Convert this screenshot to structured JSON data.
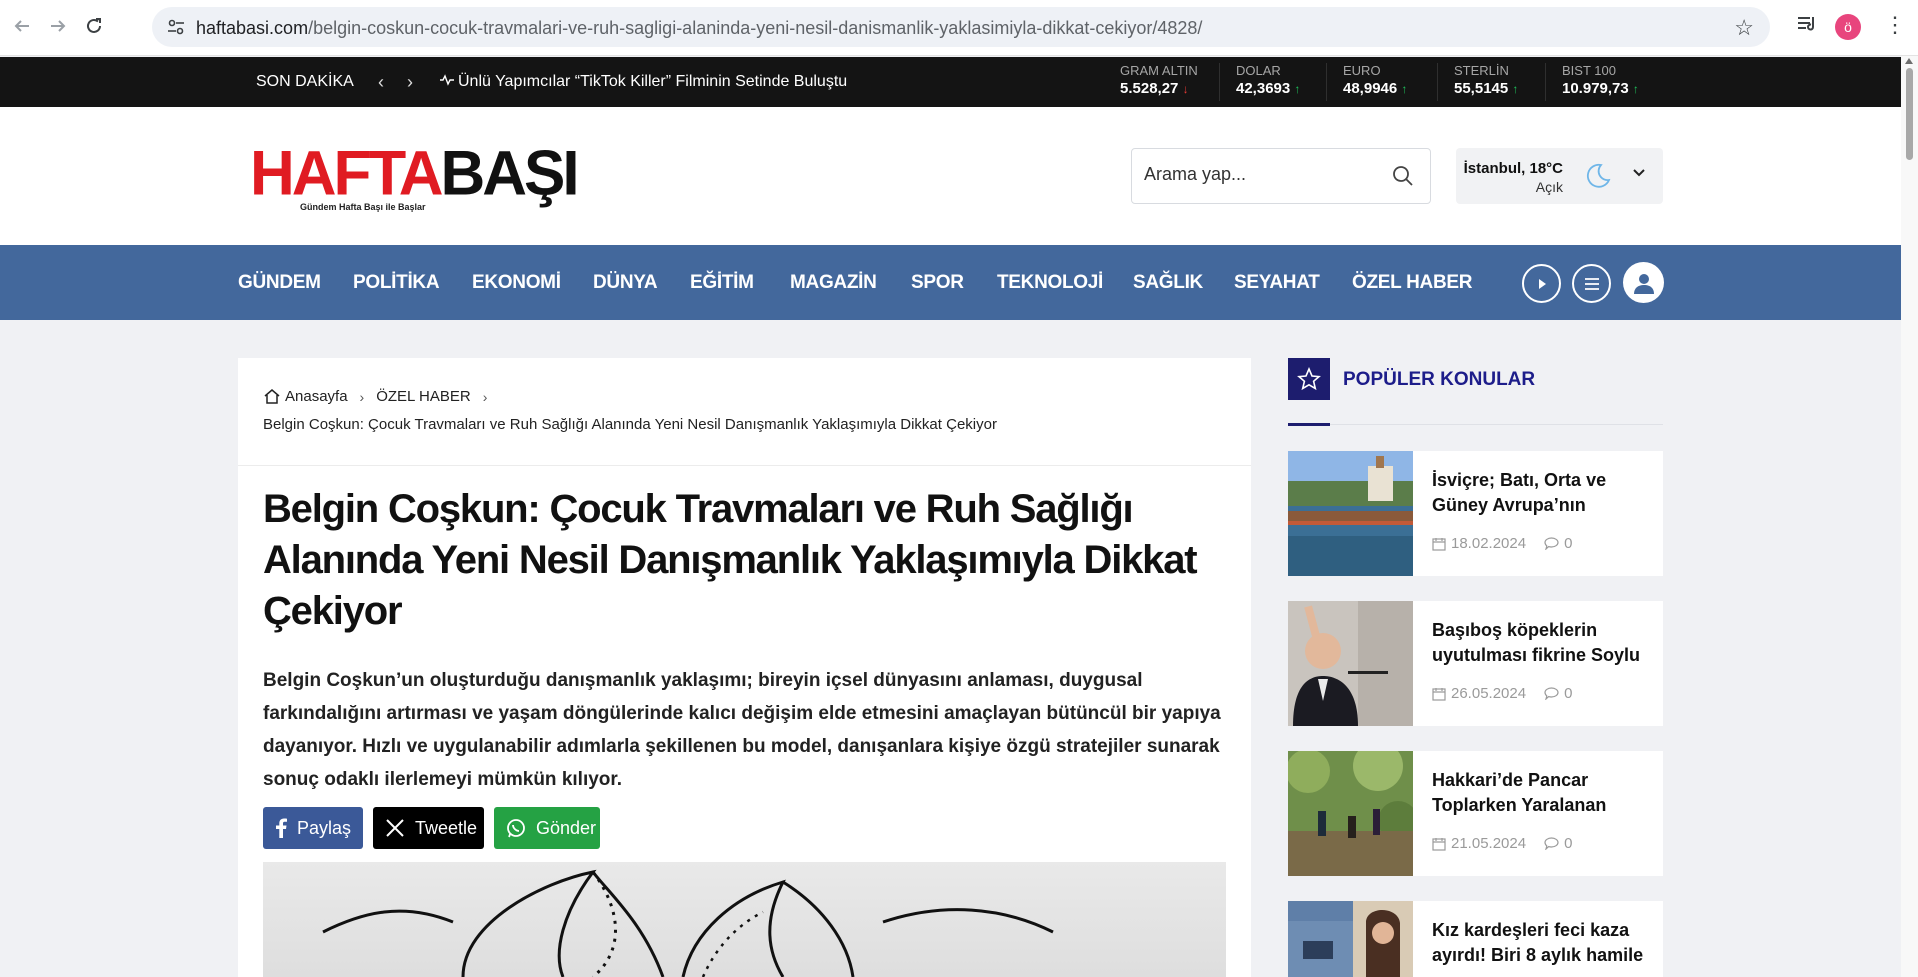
{
  "browser": {
    "url_host": "haftabasi.com",
    "url_path": "/belgin-coskun-cocuk-travmalari-ve-ruh-sagligi-alaninda-yeni-nesil-danismanlik-yaklasimiyla-dikkat-cekiyor/4828/",
    "profile_initial": "ö"
  },
  "ticker": {
    "label": "SON DAKİKA",
    "news": "Ünlü Yapımcılar “TikTok Killer” Filminin Setinde Buluştu",
    "markets": [
      {
        "name": "GRAM ALTIN",
        "value": "5.528,27",
        "trend": "down",
        "arrow": "↓"
      },
      {
        "name": "DOLAR",
        "value": "42,3693",
        "trend": "up",
        "arrow": "↑"
      },
      {
        "name": "EURO",
        "value": "48,9946",
        "trend": "up",
        "arrow": "↑"
      },
      {
        "name": "STERLİN",
        "value": "55,5145",
        "trend": "up",
        "arrow": "↑"
      },
      {
        "name": "BIST 100",
        "value": "10.979,73",
        "trend": "up",
        "arrow": "↑"
      }
    ]
  },
  "header": {
    "logo_red": "HAFTA",
    "logo_black": "BAŞI",
    "logo_tagline": "Gündem Hafta Başı ile Başlar",
    "search_placeholder": "Arama yap...",
    "weather_city": "İstanbul, 18°C",
    "weather_condition": "Açık"
  },
  "nav": {
    "categories": [
      "GÜNDEM",
      "POLİTİKA",
      "EKONOMİ",
      "DÜNYA",
      "EĞİTİM",
      "MAGAZİN",
      "SPOR",
      "TEKNOLOJİ",
      "SAĞLIK",
      "SEYAHAT",
      "ÖZEL HABER"
    ]
  },
  "article": {
    "breadcrumb_home": "Anasayfa",
    "breadcrumb_category": "ÖZEL HABER",
    "breadcrumb_current": "Belgin Coşkun: Çocuk Travmaları ve Ruh Sağlığı Alanında Yeni Nesil Danışmanlık Yaklaşımıyla Dikkat Çekiyor",
    "headline": "Belgin Coşkun: Çocuk Travmaları ve Ruh Sağlığı Alanında Yeni Nesil Danışmanlık Yaklaşımıyla Dikkat Çekiyor",
    "summary": "Belgin Coşkun’un oluşturduğu danışmanlık yaklaşımı; bireyin içsel dünyasını anlaması, duygusal farkındalığını artırması ve yaşam döngülerinde kalıcı değişim elde etmesini amaçlayan bütüncül bir yapıya dayanıyor. Hızlı ve uygulanabilir adımlarla şekillenen bu model, danışanlara kişiye özgü stratejiler sunarak sonuç odaklı ilerlemeyi mümkün kılıyor.",
    "share_facebook": "Paylaş",
    "share_x": "Tweetle",
    "share_whatsapp": "Gönder"
  },
  "sidebar": {
    "title": "POPÜLER KONULAR",
    "items": [
      {
        "title": "İsviçre; Batı, Orta ve Güney Avrupa’nın",
        "date": "18.02.2024",
        "comments": "0"
      },
      {
        "title": "Başıboş köpeklerin uyutulması fikrine Soylu",
        "date": "26.05.2024",
        "comments": "0"
      },
      {
        "title": "Hakkari’de Pancar Toplarken Yaralanan",
        "date": "21.05.2024",
        "comments": "0"
      },
      {
        "title": "Kız kardeşleri feci kaza ayırdı! Biri 8 aylık hamile",
        "date": "",
        "comments": ""
      }
    ]
  },
  "colors": {
    "nav_bg": "#43689c",
    "ticker_bg": "#141414",
    "logo_red": "#e01b22",
    "popular_accent": "#1d1d6e",
    "facebook": "#3b5998",
    "whatsapp": "#25a244"
  }
}
